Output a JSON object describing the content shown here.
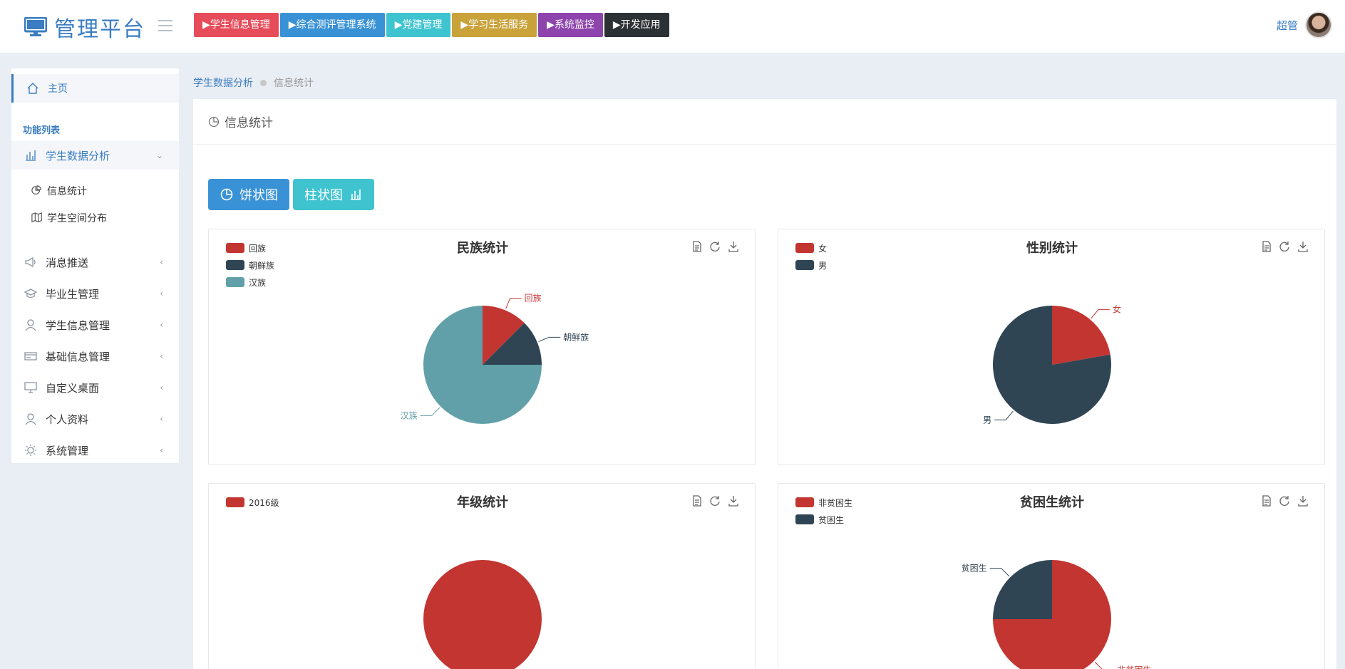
{
  "header": {
    "title": "管理平台",
    "nav": [
      {
        "label": "▶学生信息管理",
        "color": "#e64c5a"
      },
      {
        "label": "▶综合测评管理系统",
        "color": "#3a92d6"
      },
      {
        "label": "▶党建管理",
        "color": "#3fc3cf"
      },
      {
        "label": "▶学习生活服务",
        "color": "#c9a23a"
      },
      {
        "label": "▶系统监控",
        "color": "#8e44ad"
      },
      {
        "label": "▶开发应用",
        "color": "#2c3136"
      }
    ],
    "user_name": "超管"
  },
  "sidebar": {
    "home": "主页",
    "section_label": "功能列表",
    "items": [
      {
        "label": "学生数据分析",
        "icon": "bar-chart-icon",
        "chevron": "⌄"
      },
      {
        "label": "消息推送",
        "icon": "megaphone-icon",
        "chevron": "‹"
      },
      {
        "label": "毕业生管理",
        "icon": "graduation-cap-icon",
        "chevron": "‹"
      },
      {
        "label": "学生信息管理",
        "icon": "user-icon",
        "chevron": "‹"
      },
      {
        "label": "基础信息管理",
        "icon": "card-icon",
        "chevron": "‹"
      },
      {
        "label": "自定义桌面",
        "icon": "monitor-icon",
        "chevron": "‹"
      },
      {
        "label": "个人资料",
        "icon": "user-icon",
        "chevron": "‹"
      },
      {
        "label": "系统管理",
        "icon": "gear-icon",
        "chevron": "‹"
      }
    ],
    "subitems": [
      {
        "label": "信息统计",
        "icon": "pie-icon"
      },
      {
        "label": "学生空间分布",
        "icon": "map-icon"
      }
    ]
  },
  "breadcrumb": {
    "parent": "学生数据分析",
    "current": "信息统计"
  },
  "panel": {
    "title": "信息统计",
    "buttons": [
      {
        "label": "饼状图",
        "color": "#3a92d6"
      },
      {
        "label": "柱状图",
        "color": "#3fc3cf"
      }
    ]
  },
  "palette": [
    "#c23531",
    "#2f4554",
    "#61a0a8"
  ],
  "chart_data": [
    {
      "type": "pie",
      "title": "民族统计",
      "legend": "top-left",
      "categories": [
        "回族",
        "朝鲜族",
        "汉族"
      ],
      "values": [
        1,
        1,
        6
      ]
    },
    {
      "type": "pie",
      "title": "性别统计",
      "legend": "top-left",
      "categories": [
        "女",
        "男"
      ],
      "values": [
        2,
        7
      ]
    },
    {
      "type": "pie",
      "title": "年级统计",
      "legend": "top-left",
      "categories": [
        "2016级"
      ],
      "values": [
        1
      ]
    },
    {
      "type": "pie",
      "title": "贫困生统计",
      "legend": "top-left",
      "categories": [
        "非贫困生",
        "贫困生"
      ],
      "values": [
        3,
        1
      ]
    }
  ]
}
